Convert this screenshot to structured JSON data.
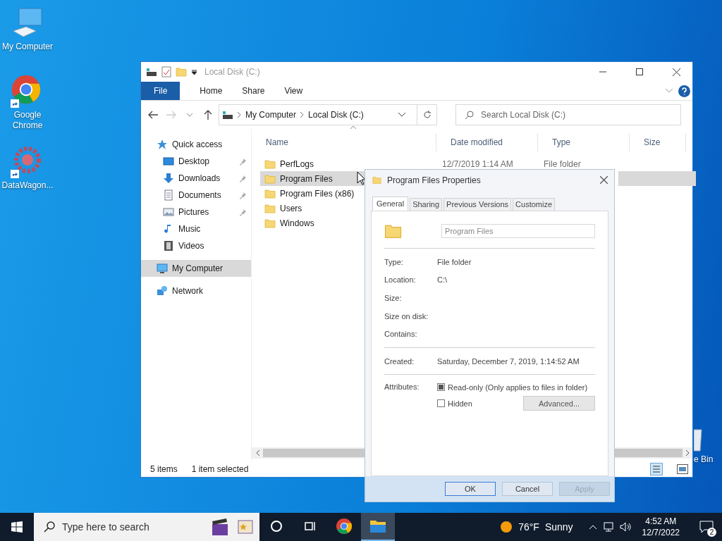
{
  "desktop": {
    "icons": [
      {
        "label": "My Computer",
        "kind": "computer",
        "shortcut": false
      },
      {
        "label": "Google Chrome",
        "kind": "chrome",
        "shortcut": true
      },
      {
        "label": "DataWagon...",
        "kind": "gear",
        "shortcut": true
      }
    ],
    "recycle_bin": {
      "label": "e Bin"
    }
  },
  "explorer": {
    "title": "Local Disk (C:)",
    "ribbon_tabs": [
      {
        "label": "File",
        "kind": "file"
      },
      {
        "label": "Home",
        "kind": "tab"
      },
      {
        "label": "Share",
        "kind": "tab"
      },
      {
        "label": "View",
        "kind": "tab"
      }
    ],
    "address": [
      "My Computer",
      "Local Disk (C:)"
    ],
    "search": {
      "placeholder": "Search Local Disk (C:)"
    },
    "nav": [
      {
        "label": "Quick access",
        "kind": "star",
        "pinned": false,
        "selected": false,
        "children": [
          {
            "label": "Desktop",
            "kind": "desktop",
            "pinned": true,
            "selected": false
          },
          {
            "label": "Downloads",
            "kind": "download",
            "pinned": true,
            "selected": false
          },
          {
            "label": "Documents",
            "kind": "document",
            "pinned": true,
            "selected": false
          },
          {
            "label": "Pictures",
            "kind": "picture",
            "pinned": true,
            "selected": false
          },
          {
            "label": "Music",
            "kind": "music",
            "pinned": false,
            "selected": false
          },
          {
            "label": "Videos",
            "kind": "video",
            "pinned": false,
            "selected": false
          }
        ]
      },
      {
        "label": "My Computer",
        "kind": "computer",
        "pinned": false,
        "selected": true
      },
      {
        "label": "Network",
        "kind": "network",
        "pinned": false,
        "selected": false
      }
    ],
    "columns": [
      "Name",
      "Date modified",
      "Type",
      "Size"
    ],
    "files": [
      {
        "name": "PerfLogs",
        "date_modified": "12/7/2019 1:14 AM",
        "type": "File folder",
        "selected": false
      },
      {
        "name": "Program Files",
        "selected": true
      },
      {
        "name": "Program Files (x86)",
        "selected": false
      },
      {
        "name": "Users",
        "selected": false
      },
      {
        "name": "Windows",
        "selected": false
      }
    ],
    "status": {
      "count": "5 items",
      "selection": "1 item selected"
    }
  },
  "dialog": {
    "title": "Program Files Properties",
    "tabs": [
      {
        "label": "General",
        "selected": true
      },
      {
        "label": "Sharing",
        "selected": false
      },
      {
        "label": "Previous Versions",
        "selected": false
      },
      {
        "label": "Customize",
        "selected": false
      }
    ],
    "name_value": "Program Files",
    "properties": [
      {
        "label": "Type:",
        "value": "File folder"
      },
      {
        "label": "Location:",
        "value": "C:\\"
      },
      {
        "label": "Size:"
      },
      {
        "label": "Size on disk:"
      },
      {
        "label": "Contains:"
      }
    ],
    "created": {
      "label": "Created:",
      "value": "Saturday, December 7, 2019, 1:14:52 AM"
    },
    "attributes": {
      "label": "Attributes:",
      "items": [
        {
          "label": "Read-only (Only applies to files in folder)",
          "checked": true
        },
        {
          "label": "Hidden",
          "checked": false
        }
      ],
      "advanced": "Advanced..."
    },
    "buttons": [
      {
        "label": "OK",
        "default": true,
        "disabled": false
      },
      {
        "label": "Cancel",
        "default": false,
        "disabled": false
      },
      {
        "label": "Apply",
        "default": false,
        "disabled": true
      }
    ]
  },
  "taskbar": {
    "search_placeholder": "Type here to search",
    "apps": [
      {
        "kind": "cortana",
        "active": false
      },
      {
        "kind": "taskview",
        "active": false
      },
      {
        "kind": "chrome",
        "active": false
      },
      {
        "kind": "explorer",
        "active": true
      }
    ],
    "weather": {
      "temp": "76°F",
      "condition": "Sunny"
    },
    "time": "4:52 AM",
    "date": "12/7/2022",
    "notifications": "2"
  }
}
